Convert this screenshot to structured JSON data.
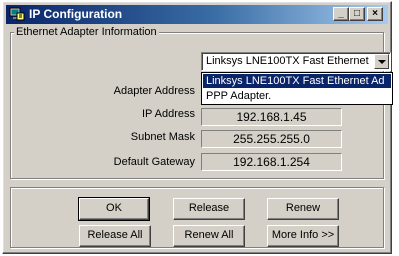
{
  "window": {
    "title": "IP Configuration",
    "controls": {
      "minimize": "_",
      "maximize": "□",
      "close": "×"
    }
  },
  "adapter_group": {
    "legend": "Ethernet  Adapter Information",
    "selected_adapter": "Linksys LNE100TX Fast Ethernet",
    "dropdown_options": [
      {
        "label": "Linksys LNE100TX Fast Ethernet Ad",
        "selected": true
      },
      {
        "label": "PPP Adapter.",
        "selected": false
      }
    ],
    "fields": {
      "adapter_address": {
        "label": "Adapter Address",
        "value": ""
      },
      "ip_address": {
        "label": "IP Address",
        "value": "192.168.1.45"
      },
      "subnet_mask": {
        "label": "Subnet Mask",
        "value": "255.255.255.0"
      },
      "default_gateway": {
        "label": "Default Gateway",
        "value": "192.168.1.254"
      }
    }
  },
  "buttons": {
    "ok": "OK",
    "release": "Release",
    "renew": "Renew",
    "release_all": "Release All",
    "renew_all": "Renew All",
    "more_info": "More Info >>"
  },
  "colors": {
    "title_gradient_start": "#0a246a",
    "title_gradient_end": "#a6caf0",
    "face": "#d4d0c8",
    "selection": "#0a246a"
  },
  "icons": {
    "app": "network-computer-icon",
    "dropdown": "chevron-down-icon"
  }
}
